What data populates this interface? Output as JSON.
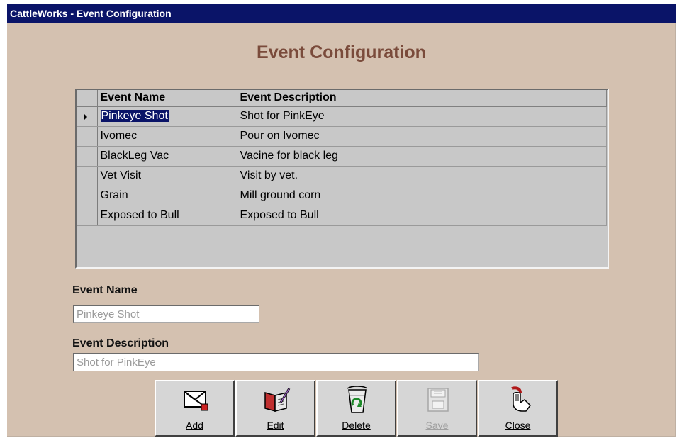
{
  "window": {
    "title": "CattleWorks - Event Configuration"
  },
  "form": {
    "heading": "Event Configuration"
  },
  "grid": {
    "columns": [
      "Event Name",
      "Event Description"
    ],
    "rows": [
      {
        "name": "Pinkeye Shot",
        "description": "Shot for PinkEye",
        "selected": true
      },
      {
        "name": "Ivomec",
        "description": "Pour on Ivomec",
        "selected": false
      },
      {
        "name": "BlackLeg Vac",
        "description": "Vacine for black leg",
        "selected": false
      },
      {
        "name": "Vet Visit",
        "description": "Visit by vet.",
        "selected": false
      },
      {
        "name": "Grain",
        "description": "Mill ground corn",
        "selected": false
      },
      {
        "name": "Exposed to Bull",
        "description": "Exposed to Bull",
        "selected": false
      }
    ]
  },
  "fields": {
    "event_name_label": "Event Name",
    "event_name_value": "Pinkeye Shot",
    "event_description_label": "Event Description",
    "event_description_value": "Shot for PinkEye"
  },
  "toolbar": {
    "buttons": [
      {
        "label": "Add",
        "icon": "add-record-icon",
        "enabled": true
      },
      {
        "label": "Edit",
        "icon": "edit-book-icon",
        "enabled": true
      },
      {
        "label": "Delete",
        "icon": "recycle-bin-icon",
        "enabled": true
      },
      {
        "label": "Save",
        "icon": "save-icon",
        "enabled": false
      },
      {
        "label": "Close",
        "icon": "close-hand-icon",
        "enabled": true
      }
    ]
  },
  "colors": {
    "titlebar": "#0a1468",
    "window_bg": "#d4c1b0",
    "heading": "#7a4b3b",
    "grid_bg": "#c8c8c8",
    "selection": "#0a1468"
  }
}
